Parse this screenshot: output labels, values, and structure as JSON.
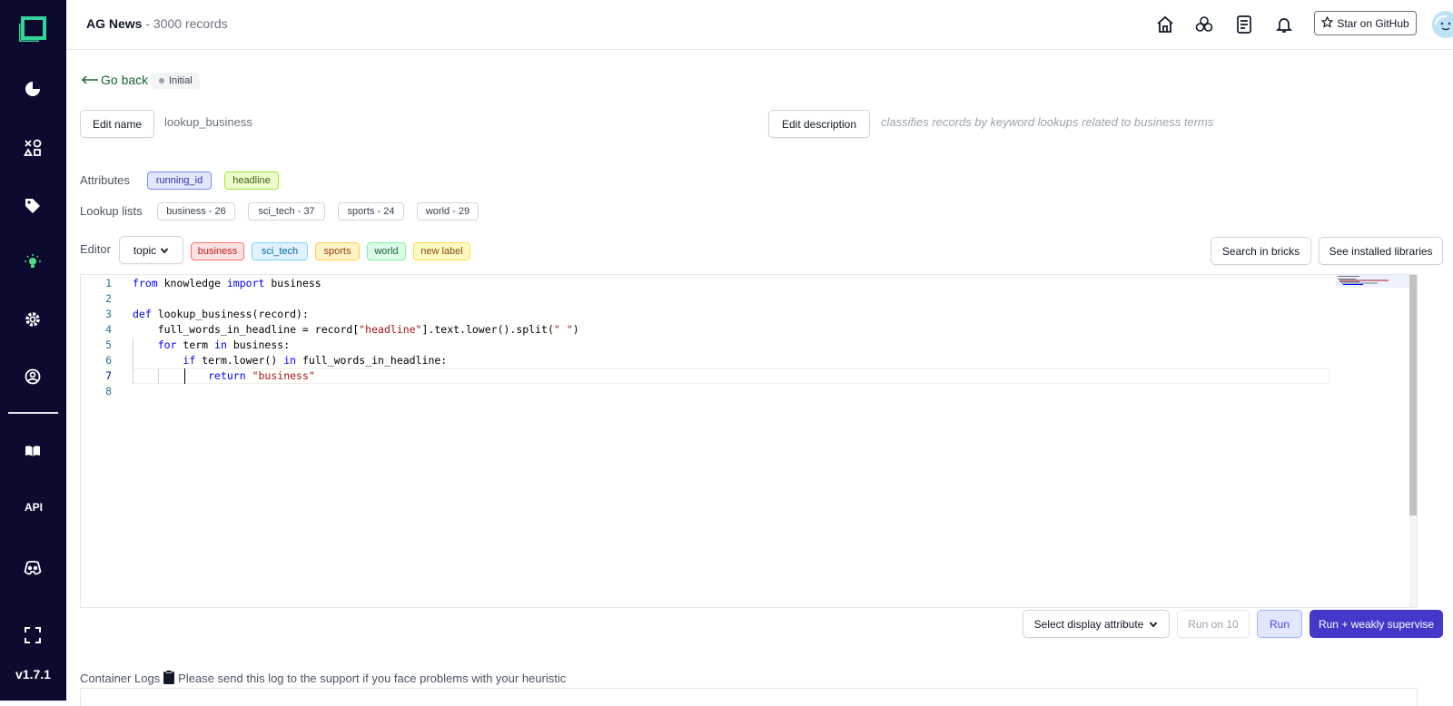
{
  "sidebar": {
    "version": "v1.7.1",
    "api_label": "API",
    "accent": "#0c0a2e",
    "logo_color": "#34d399",
    "active_icon_color": "#4ade80",
    "items": [
      "overview-icon",
      "shapes-icon",
      "tag-icon",
      "lightbulb-icon",
      "gear-icon",
      "user-circle-icon",
      "book-icon",
      "api-icon",
      "discord-icon",
      "fullscreen-icon"
    ]
  },
  "header": {
    "project_name": "AG News",
    "project_sep": " - ",
    "record_count": "3000 records",
    "github_label": "Star on GitHub"
  },
  "page": {
    "go_back": "Go back",
    "status": "Initial",
    "edit_name_label": "Edit name",
    "heuristic_name": "lookup_business",
    "edit_description_label": "Edit description",
    "description": "classifies records by keyword lookups related to business terms",
    "attributes_label": "Attributes",
    "attributes": [
      "running_id",
      "headline"
    ],
    "lookup_lists_label": "Lookup lists",
    "lookup_lists": [
      "business - 26",
      "sci_tech - 37",
      "sports - 24",
      "world - 29"
    ],
    "editor_label": "Editor",
    "task_select": "topic",
    "labels": [
      "business",
      "sci_tech",
      "sports",
      "world",
      "new label"
    ],
    "search_bricks_label": "Search in bricks",
    "installed_libraries_label": "See installed libraries"
  },
  "code": {
    "line_numbers": [
      "1",
      "2",
      "3",
      "4",
      "5",
      "6",
      "7",
      "8"
    ]
  },
  "actions": {
    "display_attribute_label": "Select display attribute",
    "run_on_10_label": "Run on 10",
    "run_label": "Run",
    "run_weakly_label": "Run + weakly supervise",
    "primary_color": "#4338ca"
  },
  "logs": {
    "title": "Container Logs",
    "hint": "Please send this log to the support if you face problems with your heuristic"
  }
}
